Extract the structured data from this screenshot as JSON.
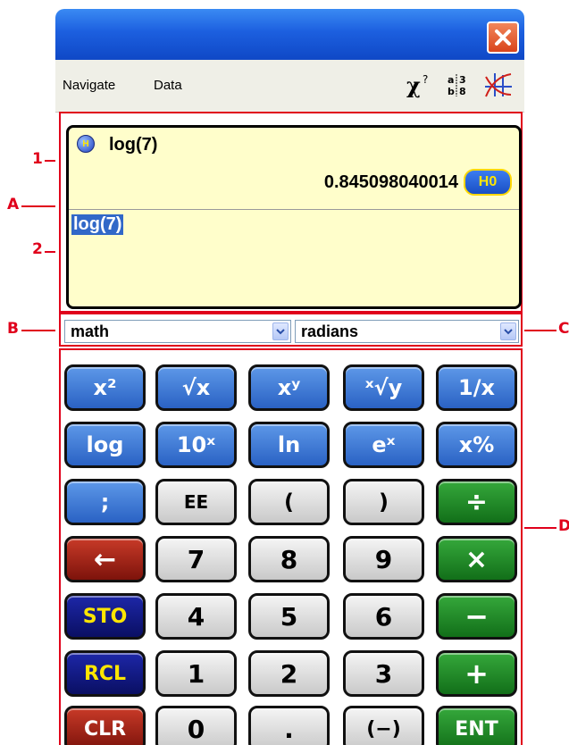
{
  "menu": {
    "navigate": "Navigate",
    "data": "Data"
  },
  "toolbar_icons": [
    "chi-squared-icon",
    "fraction-icon",
    "graph-icon"
  ],
  "display": {
    "history_badge": "H",
    "history_expression": "log(7)",
    "history_result": "0.845098040014",
    "result_badge": "H0",
    "entry": "log(7)"
  },
  "dropdowns": {
    "mode": "math",
    "angle_unit": "radians"
  },
  "callouts": {
    "one": "1",
    "two": "2",
    "A": "A",
    "B": "B",
    "C": "C",
    "D": "D"
  },
  "keys": {
    "x_squared": "x²",
    "sqrt_x": "√x",
    "x_pow_y": "xʸ",
    "xth_root_y": "ˣ√y",
    "reciprocal": "1/x",
    "log": "log",
    "ten_pow": "10ˣ",
    "ln": "ln",
    "e_pow": "eˣ",
    "percent": "x%",
    "semicolon": ";",
    "ee": "EE",
    "open_paren": "(",
    "close_paren": ")",
    "divide": "÷",
    "backspace": "←",
    "seven": "7",
    "eight": "8",
    "nine": "9",
    "multiply": "×",
    "sto": "STO",
    "four": "4",
    "five": "5",
    "six": "6",
    "minus": "−",
    "rcl": "RCL",
    "one": "1",
    "two": "2",
    "three": "3",
    "plus": "+",
    "clr": "CLR",
    "zero": "0",
    "decimal": ".",
    "negative": "(−)",
    "enter": "ENT"
  },
  "colors": {
    "annotation_red": "#e0001b",
    "display_bg": "#fffecb",
    "key_blue": "#2a62c4",
    "key_green": "#126f19",
    "key_red": "#7d130b",
    "key_navy": "#0a0f63",
    "key_gray": "#c9c9c9"
  }
}
